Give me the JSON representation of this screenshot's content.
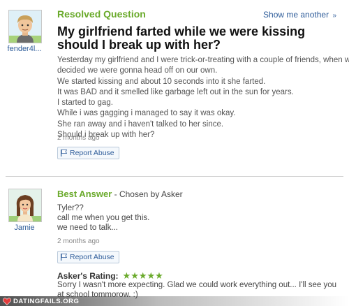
{
  "question": {
    "status": "Resolved Question",
    "show_another": "Show me another",
    "show_another_arrow": "»",
    "asker": {
      "name": "fender4l...",
      "avatar": "cartoon-boy-avatar"
    },
    "title": "My girlfriend farted while we were kissing should I break up with her?",
    "body_lines": [
      "Yesterday my girlfriend and I were trick-or-treating with a couple of friends, when we",
      "decided we were gonna head off on our own.",
      "We started kissing and about 10 seconds into it she farted.",
      "It was BAD and it smelled like garbage left out in the sun for years.",
      "I started to gag.",
      "While i was gagging i managed to say it was okay.",
      "She ran away and i haven't talked to her since.",
      "Should i break up with her?"
    ],
    "timestamp": "2 months ago",
    "report_label": "Report Abuse"
  },
  "answer": {
    "label": "Best Answer",
    "chosen_by": " - Chosen by Asker",
    "answerer": {
      "name": "Jamie",
      "avatar": "cartoon-girl-avatar"
    },
    "body_lines": [
      "Tyler??",
      "call me when you get this.",
      "we need to talk..."
    ],
    "timestamp": "2 months ago",
    "report_label": "Report Abuse",
    "rating_label": "Asker's Rating:",
    "rating_stars": "★★★★★",
    "rating_value": 5,
    "rating_max": 5,
    "rating_comment": "Sorry I wasn't more expecting. Glad we could work everything out... I'll see you at school tommorow. :)"
  },
  "watermark": "DATINGFAILS.ORG",
  "colors": {
    "accent_green": "#6aaa2b",
    "link_blue": "#2f5d9a",
    "title_black": "#111111"
  }
}
